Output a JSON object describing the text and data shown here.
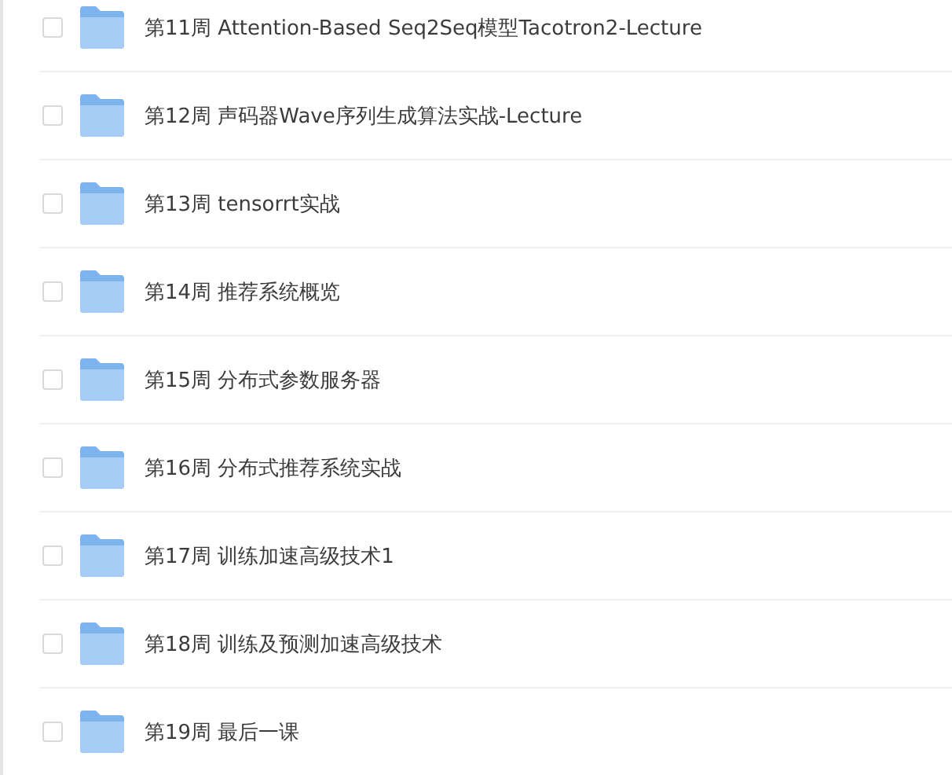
{
  "files": [
    {
      "name": "第11周 Attention-Based Seq2Seq模型Tacotron2-Lecture",
      "checked": false
    },
    {
      "name": "第12周 声码器Wave序列生成算法实战-Lecture",
      "checked": false
    },
    {
      "name": "第13周 tensorrt实战",
      "checked": false
    },
    {
      "name": "第14周 推荐系统概览",
      "checked": false
    },
    {
      "name": "第15周 分布式参数服务器",
      "checked": false
    },
    {
      "name": "第16周 分布式推荐系统实战",
      "checked": false
    },
    {
      "name": "第17周 训练加速高级技术1",
      "checked": false
    },
    {
      "name": "第18周 训练及预测加速高级技术",
      "checked": false
    },
    {
      "name": "第19周 最后一课",
      "checked": false
    }
  ]
}
